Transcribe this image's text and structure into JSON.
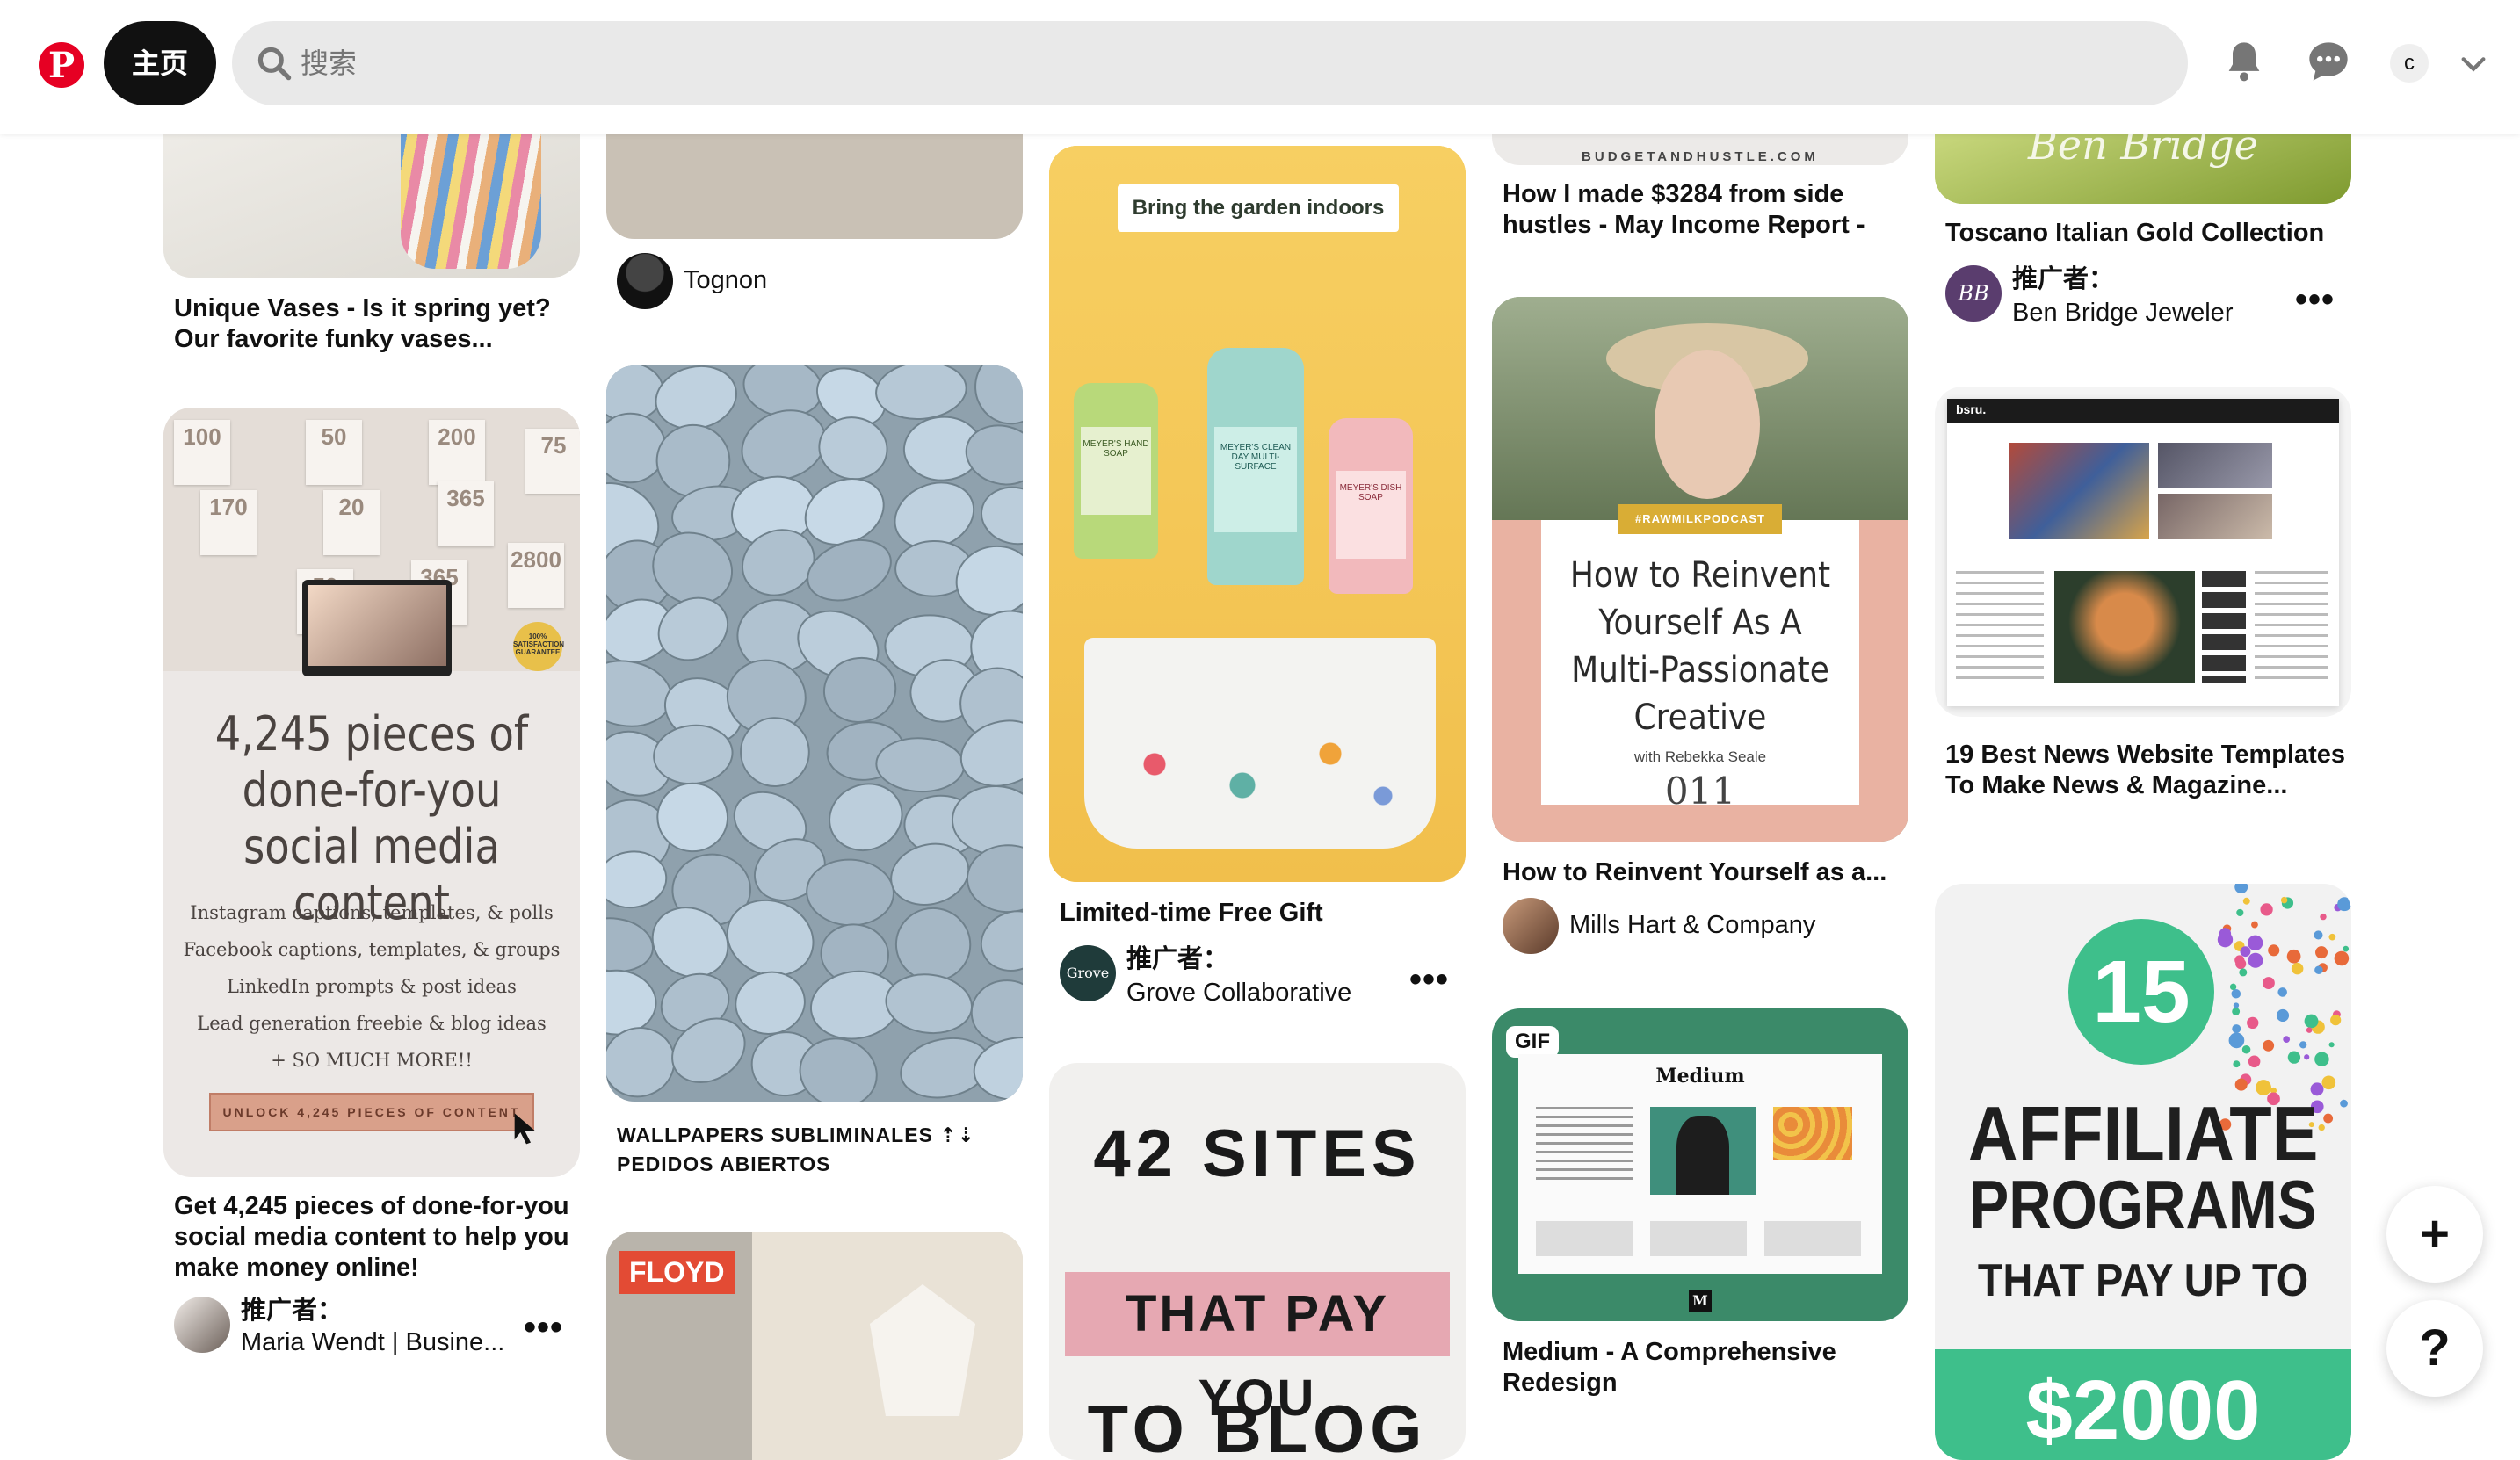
{
  "header": {
    "logo_letter": "P",
    "home_label": "主页",
    "search_placeholder": "搜索",
    "account_initial": "c",
    "brand_color": "#e60023"
  },
  "pins": {
    "col1": {
      "vase_title": "Unique Vases - Is it spring yet? Our favorite funky vases...",
      "social_overlay_headline": "4,245 pieces of done-for-you social media content",
      "social_overlay_lines": [
        "Instagram captions, templates, & polls",
        "Facebook captions, templates, & groups",
        "LinkedIn prompts & post ideas",
        "Lead generation freebie & blog ideas",
        "+ SO MUCH MORE!!"
      ],
      "social_overlay_cta": "UNLOCK 4,245 PIECES OF CONTENT",
      "social_overlay_numbers": [
        "100",
        "50",
        "200",
        "75",
        "170",
        "20",
        "365",
        "50",
        "365",
        "2800"
      ],
      "social_overlay_badge": "100% SATISFACTION GUARANTEE",
      "social_title": "Get 4,245 pieces of done-for-you social media content to help you make money online!",
      "social_promo": "推广者：",
      "social_author": "Maria Wendt | Busine..."
    },
    "col2": {
      "top_author": "Tognon",
      "stones_title": "WALLPAPERS SUBLIMINALES ⇡⇣ PEDIDOS ABIERTOS",
      "floyd_badge": "FLOYD"
    },
    "col3": {
      "garden_overlay": "Bring the garden indoors",
      "garden_labels": [
        "MEYER'S HAND SOAP",
        "MEYER'S CLEAN DAY MULTI-SURFACE",
        "MEYER'S DISH SOAP"
      ],
      "garden_title": "Limited-time Free Gift",
      "garden_promo": "推广者：",
      "garden_author": "Grove Collaborative",
      "grove_logo": "Grove",
      "sites_line1": "42 SITES",
      "sites_line2": "THAT PAY YOU",
      "sites_line3": "TO BLOG"
    },
    "col4": {
      "budget_watermark": "BUDGETANDHUSTLE.COM",
      "budget_title": "How I made $3284 from side hustles - May Income Report -",
      "reinvent_tag": "#RAWMILKPODCAST",
      "reinvent_heading": "How to Reinvent Yourself As A Multi-Passionate Creative",
      "reinvent_with": "with Rebekka Seale",
      "reinvent_episode": "011",
      "reinvent_title": "How to Reinvent Yourself as a...",
      "reinvent_author": "Mills Hart & Company",
      "gif_badge": "GIF",
      "medium_masthead": "Medium",
      "medium_logo": "M",
      "medium_title": "Medium - A Comprehensive Redesign"
    },
    "col5": {
      "bridge_script": "Ben Bridge",
      "bridge_title": "Toscano Italian Gold Collection",
      "bridge_promo": "推广者：",
      "bridge_author": "Ben Bridge Jeweler",
      "bridge_logo": "BB",
      "news_title": "19 Best News Website Templates To Make News & Magazine...",
      "news_site_logo": "bsru.",
      "affiliate_number": "15",
      "affiliate_line1": "AFFILIATE",
      "affiliate_line2": "PROGRAMS",
      "affiliate_line3": "THAT PAY UP TO",
      "affiliate_amount": "$2000"
    }
  },
  "fab": {
    "add": "+",
    "help": "?"
  }
}
